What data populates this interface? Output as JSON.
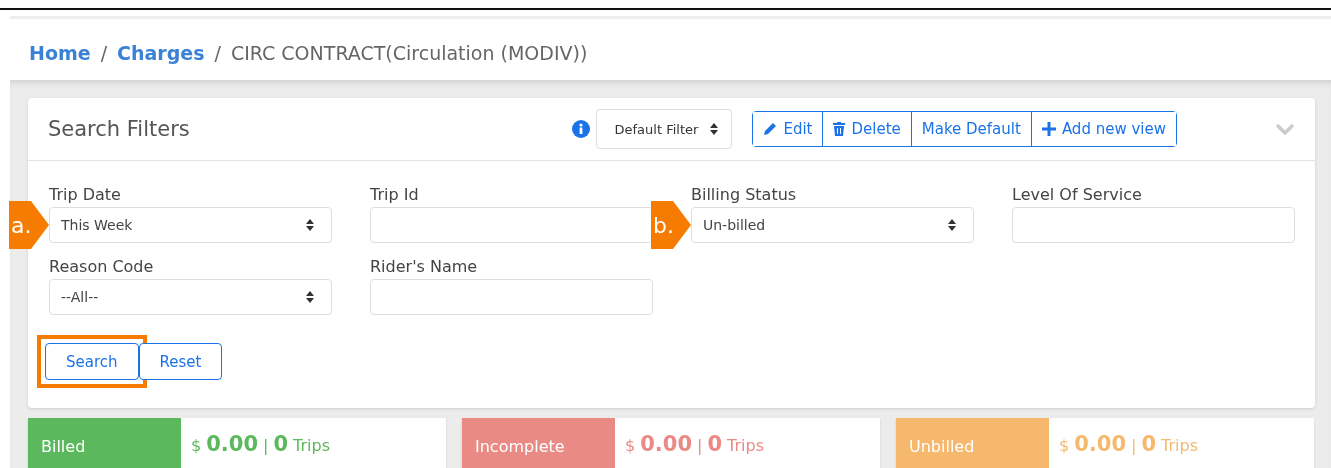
{
  "breadcrumb": [
    {
      "label": "Home",
      "kind": "link"
    },
    {
      "label": "/",
      "kind": "separator"
    },
    {
      "label": "Charges",
      "kind": "link"
    },
    {
      "label": "/",
      "kind": "separator"
    },
    {
      "label": "CIRC CONTRACT(Circulation (MODIV))",
      "kind": "current"
    }
  ],
  "panel": {
    "title": "Search Filters",
    "view_select": "Default Filter",
    "actions": [
      {
        "label": "Edit",
        "kind": "edit"
      },
      {
        "label": "Delete",
        "kind": "delete"
      },
      {
        "label": "Make Default",
        "kind": "text"
      },
      {
        "label": "Add new view",
        "kind": "add"
      }
    ],
    "expanded": true
  },
  "fields": [
    {
      "label": "Trip Date",
      "kind": "select",
      "value": "This Week",
      "callout": "a."
    },
    {
      "label": "Trip Id",
      "kind": "input"
    },
    {
      "label": "Billing Status",
      "kind": "select",
      "value": "Un-billed",
      "callout": "b."
    },
    {
      "label": "Level Of Service",
      "kind": "input"
    },
    {
      "label": "Reason Code",
      "kind": "select",
      "value": "--All--"
    },
    {
      "label": "Rider's Name",
      "kind": "input"
    }
  ],
  "buttons": [
    {
      "label": "Search",
      "highlighted": true
    },
    {
      "label": "Reset",
      "highlighted": false
    }
  ],
  "summary": [
    {
      "label": "Billed",
      "color": "#5cb85c",
      "currency": "$",
      "amount": "0.00",
      "separator": "|",
      "count": "0",
      "unit": "Trips"
    },
    {
      "label": "Incomplete",
      "color": "#e98a84",
      "currency": "$",
      "amount": "0.00",
      "separator": "|",
      "count": "0",
      "unit": "Trips"
    },
    {
      "label": "Unbilled",
      "color": "#f6b86c",
      "currency": "$",
      "amount": "0.00",
      "separator": "|",
      "count": "0",
      "unit": "Trips"
    }
  ]
}
